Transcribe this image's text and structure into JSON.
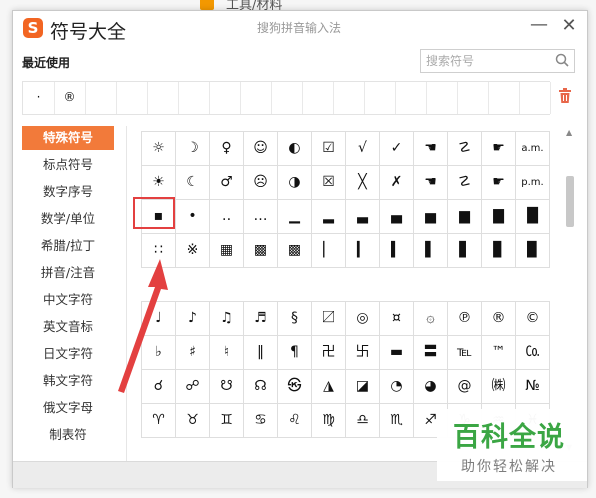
{
  "background": {
    "behind_text": "工具/材料"
  },
  "window": {
    "logo_letter": "S",
    "title": "符号大全",
    "subtitle": "搜狗拼音输入法",
    "minimize_glyph": "—",
    "close_glyph": "✕"
  },
  "recent": {
    "label": "最近使用",
    "items": [
      "·",
      "®",
      "",
      "",
      "",
      "",
      "",
      "",
      "",
      "",
      "",
      "",
      "",
      "",
      "",
      "",
      ""
    ]
  },
  "search": {
    "placeholder": "搜索符号"
  },
  "sidebar": {
    "items": [
      {
        "label": "特殊符号",
        "active": true
      },
      {
        "label": "标点符号",
        "active": false
      },
      {
        "label": "数字序号",
        "active": false
      },
      {
        "label": "数学/单位",
        "active": false
      },
      {
        "label": "希腊/拉丁",
        "active": false
      },
      {
        "label": "拼音/注音",
        "active": false
      },
      {
        "label": "中文字符",
        "active": false
      },
      {
        "label": "英文音标",
        "active": false
      },
      {
        "label": "日文字符",
        "active": false
      },
      {
        "label": "韩文字符",
        "active": false
      },
      {
        "label": "俄文字母",
        "active": false
      },
      {
        "label": "制表符",
        "active": false
      }
    ]
  },
  "grid1": {
    "rows": [
      [
        "☼",
        "☽",
        "♀",
        "☺",
        "◐",
        "☑",
        "√",
        "✓",
        "☚",
        "☡",
        "☛",
        "a.m."
      ],
      [
        "☀",
        "☾",
        "♂",
        "☹",
        "◑",
        "☒",
        "╳",
        "✗",
        "☚",
        "☡",
        "☛",
        "p.m."
      ],
      [
        "▪",
        "•",
        "‥",
        "…",
        "▁",
        "▂",
        "▃",
        "▄",
        "▅",
        "▆",
        "▇",
        "█"
      ],
      [
        "∷",
        "※",
        "▦",
        "▩",
        "▩",
        "▏",
        "▎",
        "▍",
        "▌",
        "▋",
        "▊",
        "▉"
      ]
    ]
  },
  "grid2": {
    "rows": [
      [
        "♩",
        "♪",
        "♫",
        "♬",
        "§",
        "〼",
        "◎",
        "¤",
        "۞",
        "℗",
        "®",
        "©"
      ],
      [
        "♭",
        "♯",
        "♮",
        "‖",
        "¶",
        "卍",
        "卐",
        "▬",
        "〓",
        "℡",
        "™",
        "㏇"
      ],
      [
        "☌",
        "☍",
        "☋",
        "☊",
        "㉿",
        "◮",
        "◪",
        "◔",
        "◕",
        "@",
        "㈱",
        "№"
      ],
      [
        "♈",
        "♉",
        "♊",
        "♋",
        "♌",
        "♍",
        "♎",
        "♏",
        "♐",
        "♑",
        "♒",
        "♓"
      ]
    ]
  },
  "watermark": {
    "big_text": "百科全说",
    "small_text": "助你轻松解决",
    "color": "#3ba644"
  },
  "colors": {
    "accent": "#f27a3a",
    "highlight": "#e34040"
  }
}
